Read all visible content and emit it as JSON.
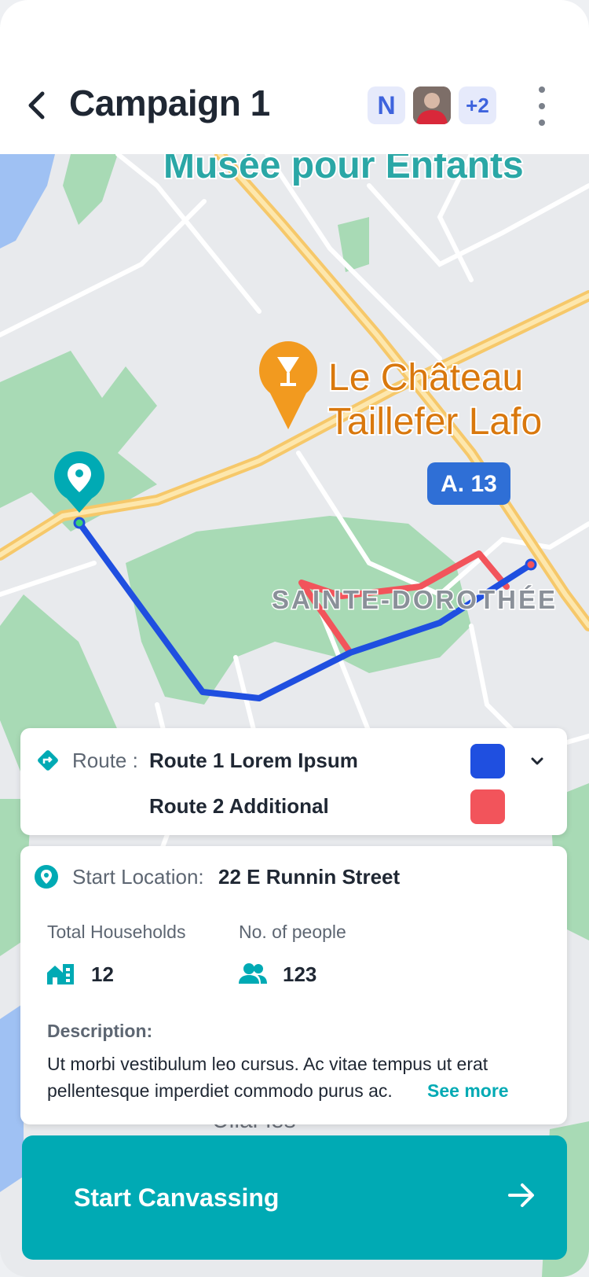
{
  "header": {
    "title": "Campaign 1",
    "avatar_initial": "N",
    "avatar_more": "+2"
  },
  "map": {
    "labels": {
      "museum": "Musée pour Enfants",
      "place": "Le Château",
      "place_line2": "Taillefer Lafo",
      "highway": "A. 13",
      "district": "SAINTE-DOROTHÉE",
      "bottom_partial": "Ullal-les"
    }
  },
  "route_card": {
    "route_label": "Route :",
    "route_1": "Route 1 Lorem Ipsum",
    "route_2": "Route 2 Additional",
    "route_1_color": "#1f4fe0",
    "route_2_color": "#f2545b"
  },
  "info_card": {
    "start_location_label": "Start Location:",
    "start_location_value": "22 E Runnin Street",
    "households_label": "Total Households",
    "households_value": "12",
    "people_label": "No. of people",
    "people_value": "123",
    "description_label": "Description:",
    "description_line1": "Ut morbi vestibulum leo cursus. Ac vitae tempus ut erat",
    "description_line2": "pellentesque imperdiet commodo purus ac.",
    "see_more": "See more"
  },
  "cta": {
    "label": "Start Canvassing"
  },
  "colors": {
    "accent": "#00aab4",
    "text_dark": "#1f2733",
    "text_muted": "#5d6672",
    "avatar_bg": "#e6eafb",
    "avatar_text": "#3e63dd"
  }
}
